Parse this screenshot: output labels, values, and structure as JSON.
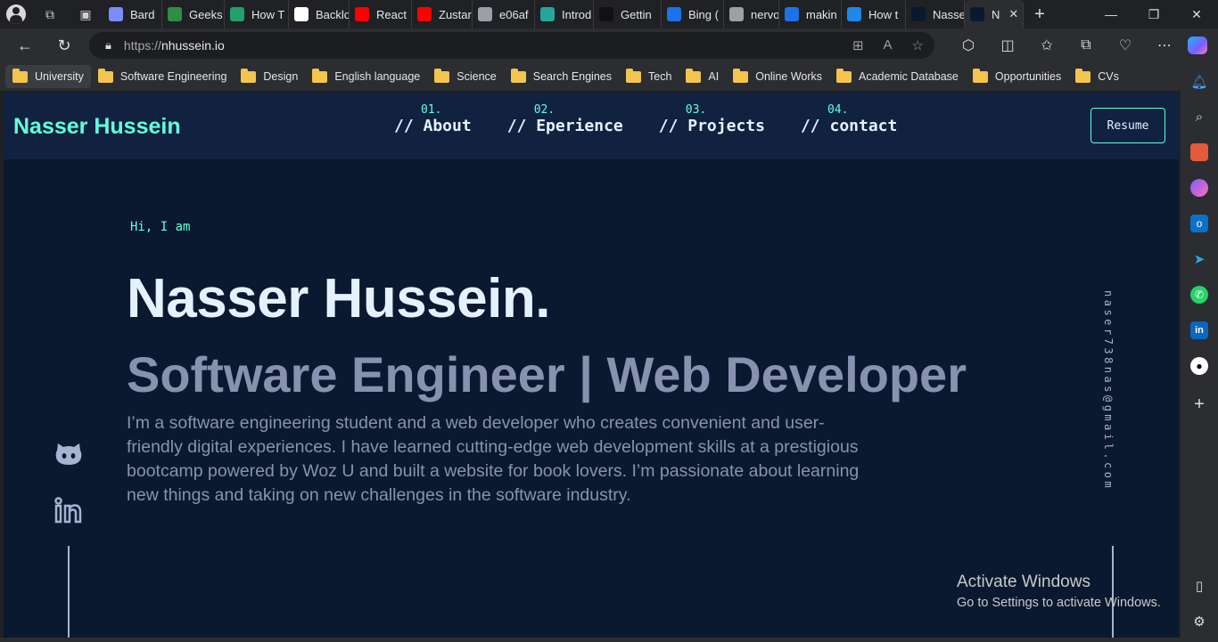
{
  "browser": {
    "tabs": [
      {
        "label": "Bard",
        "color": "#7b8cff"
      },
      {
        "label": "Geeks",
        "color": "#2f8d46"
      },
      {
        "label": "How T",
        "color": "#22a06b"
      },
      {
        "label": "Backlo",
        "color": "#ffffff"
      },
      {
        "label": "React",
        "color": "#ff0000"
      },
      {
        "label": "Zustar",
        "color": "#ff0000"
      },
      {
        "label": "e06af",
        "color": "#9aa0a6"
      },
      {
        "label": "Introd",
        "color": "#26a69a"
      },
      {
        "label": "Gettin",
        "color": "#111111"
      },
      {
        "label": "Bing (",
        "color": "#1a73e8"
      },
      {
        "label": "nervo",
        "color": "#9aa0a6"
      },
      {
        "label": "makin",
        "color": "#1a73e8"
      },
      {
        "label": "How t",
        "color": "#1e88e5"
      },
      {
        "label": "Nasse",
        "color": "#0a192f"
      },
      {
        "label": "N",
        "color": "#0a192f"
      }
    ],
    "url_protocol": "https://",
    "url_host": "nhussein.io",
    "bookmarks": [
      "University",
      "Software Engineering",
      "Design",
      "English language",
      "Science",
      "Search Engines",
      "Tech",
      "AI",
      "Online Works",
      "Academic Database",
      "Opportunities",
      "CVs"
    ]
  },
  "site": {
    "brand": "Nasser Hussein",
    "nav": [
      {
        "num": "01.",
        "label": "// About"
      },
      {
        "num": "02.",
        "label": "// Eperience"
      },
      {
        "num": "03.",
        "label": "// Projects"
      },
      {
        "num": "04.",
        "label": "// contact"
      }
    ],
    "resume_label": "Resume",
    "greeting": "Hi, I am",
    "name": "Nasser Hussein.",
    "role": "Software Engineer | Web Developer",
    "description": "I’m a software engineering student and a web developer who creates convenient and user-friendly digital experiences. I have learned cutting-edge web development skills at a prestigious bootcamp powered by Woz U and built a website for book lovers. I’m passionate about learning new things and taking on new challenges in the software industry.",
    "email": "naser738nas@gmail.com"
  },
  "watermark": {
    "title": "Activate Windows",
    "subtitle": "Go to Settings to activate Windows."
  },
  "colors": {
    "accent": "#64ffda",
    "page_bg": "#0a192f",
    "nav_bg": "#112240",
    "muted_text": "#8892b0"
  }
}
